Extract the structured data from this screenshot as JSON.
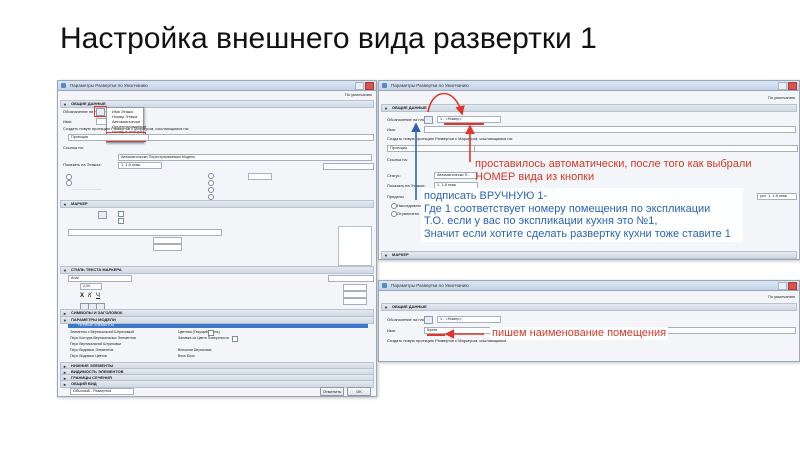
{
  "slide": {
    "title": "Настройка внешнего вида развертки 1"
  },
  "dialog_main": {
    "title": "Параметры Развертки по Умолчанию",
    "right_label": "По умолчанию",
    "section_general": "ОБЩИЕ ДАННЫЕ",
    "label_ref": "Обозначение на плане:",
    "label_name": "Имя:",
    "label_create": "Создать новую проекцию Развертки с Маркером, ссылающимся на:",
    "field_projection": "Проекция",
    "label_source": "Ссылка на:",
    "field_source": "Автоматически Перестраиваемая Модель",
    "label_show": "Показать на Этажах:",
    "field_show": "1. 1-й этаж",
    "dropdown_items": [
      "Имя Этажа",
      "Номер Этажа",
      "Автоматически",
      "Ориентированные",
      "Номер в Наборе",
      "Первый автоматически"
    ],
    "dropdown_selected": "Первый автоматически",
    "section_marker": "МАРКЕР",
    "section_style": "СТИЛЬ ТЕКСТА МАРКЕРА",
    "font_name": "Arial",
    "font_size": "2,00",
    "section_model": "ПАРАМЕТРЫ МОДЕЛИ",
    "section_names": "СИМВОЛЫ И ЗАГОЛОВОК",
    "section_titles": "ПЕРВЫЕ ЭЛЕМЕНТЫ",
    "row_labels": [
      "Элементы с Вертикальной Штриховкой",
      "Перо Контура Вертикальных Элементов",
      "Перо Вертикальной Штриховки",
      "Перо Видимых Элементов",
      "Перо Видимых Цветов"
    ],
    "row_values": [
      "Цветная (Текущий Стиль)",
      "Заливка из Цвета Поверхности",
      "Внешняя Штриховка",
      "Весь Блок"
    ],
    "section_bottom_1": "НИЖНИЕ ЭЛЕМЕНТЫ",
    "section_bottom_2": "ВИДИМОСТЬ ЭЛЕМЕНТОВ",
    "section_bottom_3": "ГРАНИЦЫ СЕЧЕНИЯ",
    "section_bottom_4": "ОБЩИЙ ВИД",
    "footer_field": "Обычный - Развертка",
    "btn_cancel": "Отменить",
    "btn_ok": "OK"
  },
  "dialog_top_right": {
    "title": "Параметры Развертки по Умолчанию",
    "right_label": "По умолчанию",
    "section_general": "ОБЩИЕ ДАННЫЕ",
    "label_ref": "Обозначение на плане:",
    "field_ref": "1 - <Номер>",
    "label_name": "Имя:",
    "label_create": "Создать новую проекцию Развертки с Маркером, ссылающимся на:",
    "field_projection": "Проекция",
    "label_source": "Ссылка на:",
    "label_status": "Статус:",
    "field_status": "Автоматически П...",
    "label_show": "Показать на Этажах:",
    "field_show": "1. 1-й этаж",
    "label_limits": "Пределы",
    "scale_value": "усл. 1, 1-й этаж",
    "radio_1": "Наследовать",
    "radio_2": "Ограничено",
    "section_marker": "МАРКЕР"
  },
  "dialog_bottom_right": {
    "title": "Параметры Развертки по Умолчанию",
    "right_label": "По умолчанию",
    "section_general": "ОБЩИЕ ДАННЫЕ",
    "label_ref": "Обозначение на плане:",
    "field_ref": "1 - <Номер>",
    "label_name": "Имя:",
    "field_name": "Кухня",
    "label_create": "Создать новую проекцию Развертки с Маркером, ссылающимся"
  },
  "annotations": {
    "red_note_1": [
      "проставилось автоматически, после того как выбрали",
      "НОМЕР вида из кнопки"
    ],
    "blue_note": [
      "подписать ВРУЧНУЮ 1-",
      "Где 1 соответствует номеру помещения по экспликации",
      "Т.О. если у вас по экспликации кухня это №1,",
      "Значит если хотите сделать развертку кухни тоже ставите 1"
    ],
    "red_note_2": "пишем наименование помещения"
  },
  "colors": {
    "annotation_red": "#d23a2a",
    "annotation_blue": "#2e63b8",
    "selection_blue": "#3b78c9"
  }
}
